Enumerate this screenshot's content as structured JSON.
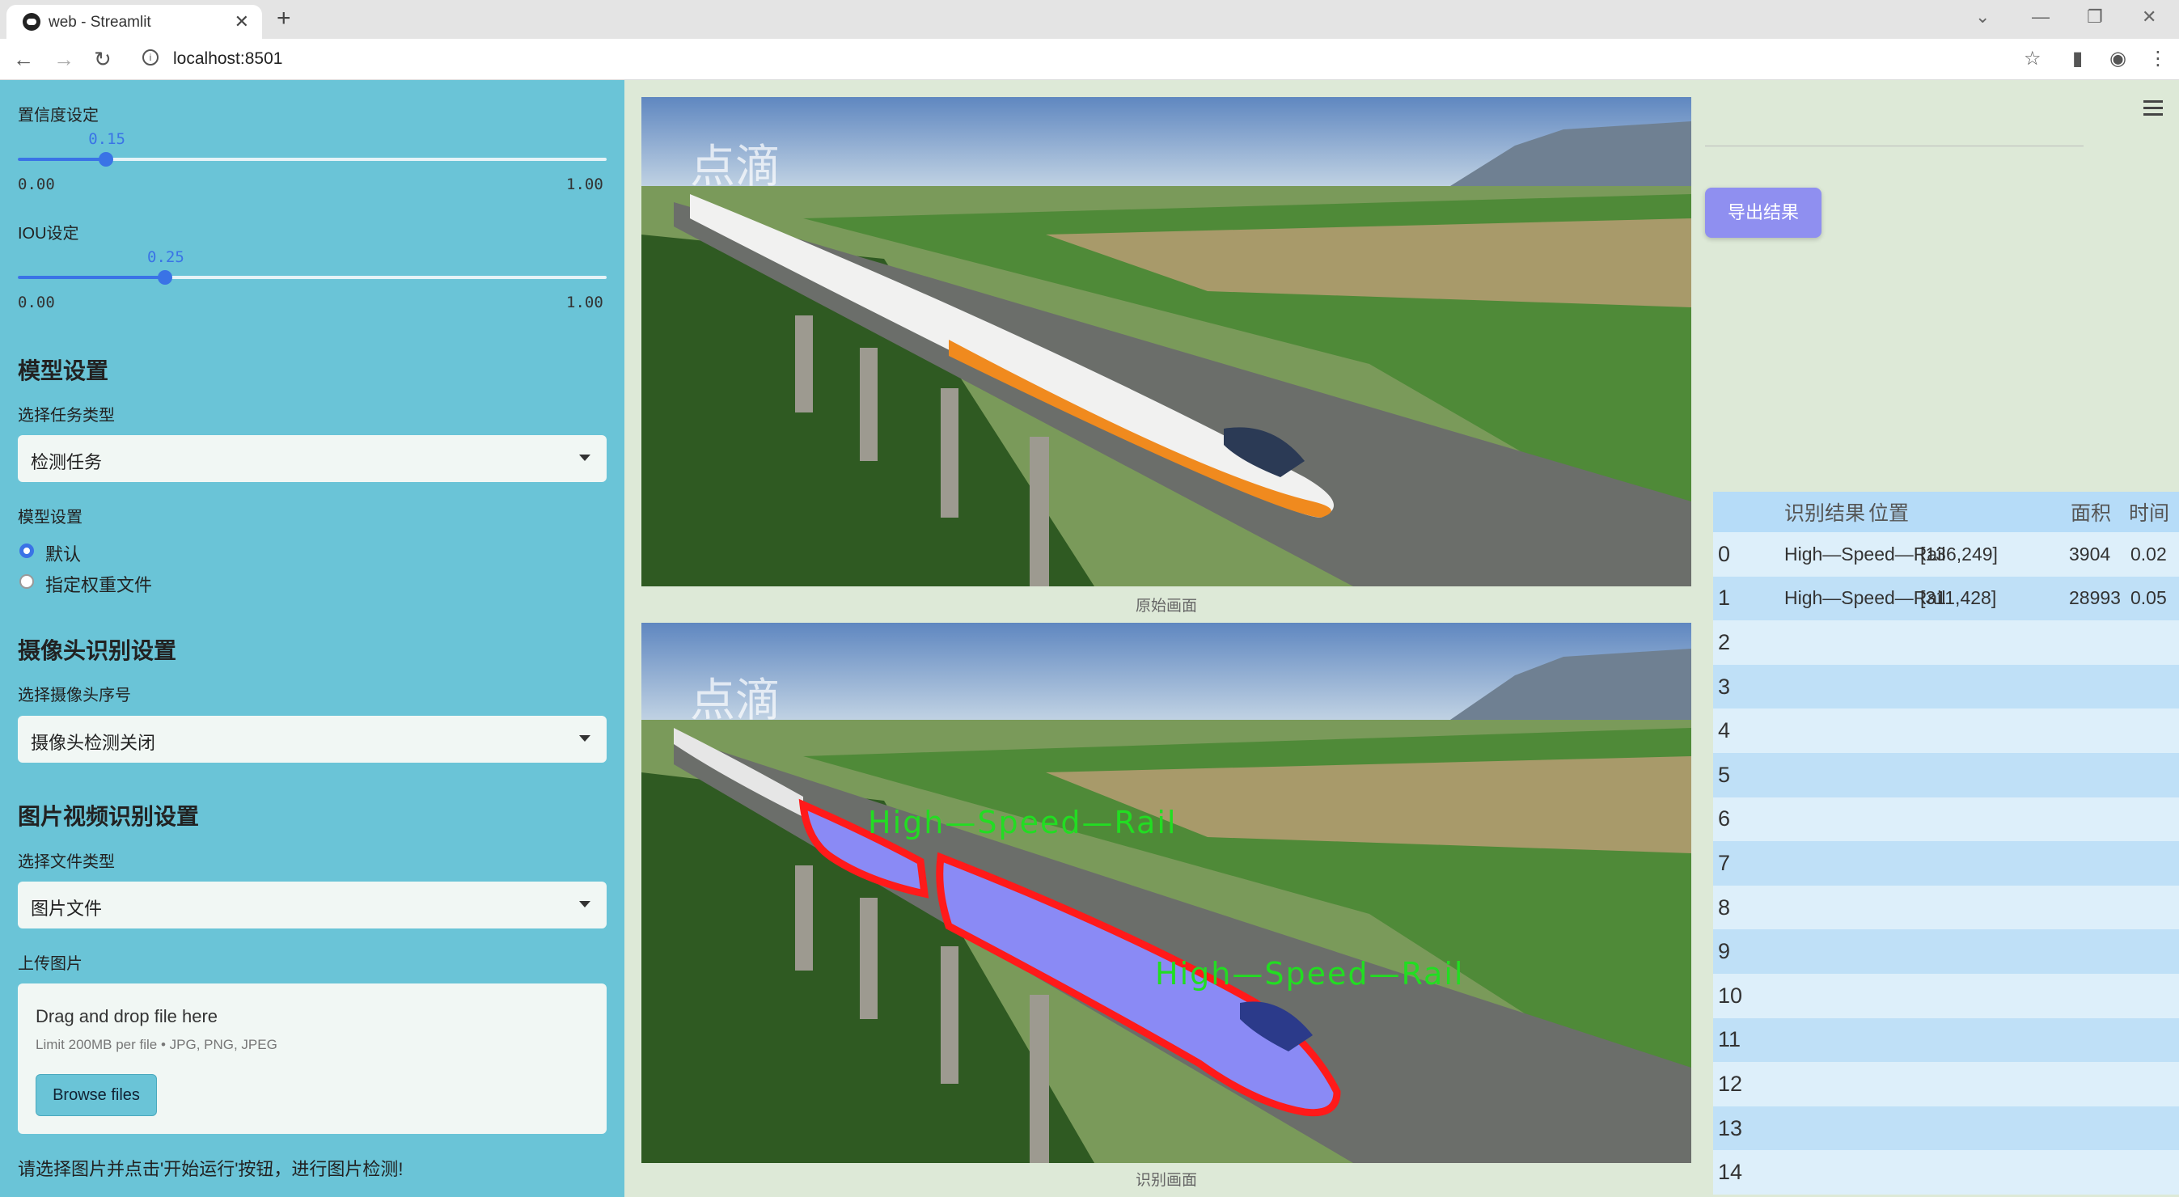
{
  "browser": {
    "tab_title": "web - Streamlit",
    "url": "localhost:8501"
  },
  "sidebar": {
    "confidence": {
      "label": "置信度设定",
      "value": "0.15",
      "value_num": 0.15,
      "min": "0.00",
      "max": "1.00"
    },
    "iou": {
      "label": "IOU设定",
      "value": "0.25",
      "value_num": 0.25,
      "min": "0.00",
      "max": "1.00"
    },
    "model_section": {
      "title": "模型设置",
      "task_label": "选择任务类型",
      "task_value": "检测任务",
      "model_label": "模型设置",
      "options": [
        "默认",
        "指定权重文件"
      ],
      "selected": "默认"
    },
    "camera_section": {
      "title": "摄像头识别设置",
      "camera_label": "选择摄像头序号",
      "camera_value": "摄像头检测关闭"
    },
    "media_section": {
      "title": "图片视频识别设置",
      "type_label": "选择文件类型",
      "type_value": "图片文件",
      "upload_label": "上传图片",
      "dropzone_text": "Drag and drop file here",
      "dropzone_limit": "Limit 200MB per file • JPG, PNG, JPEG",
      "browse_label": "Browse files"
    },
    "hint": "请选择图片并点击'开始运行'按钮，进行图片检测!"
  },
  "main": {
    "original_caption": "原始画面",
    "result_caption": "识别画面",
    "detection_label_1": "High—Speed—Rail",
    "detection_label_2": "High—Speed—Rail",
    "watermark": "点滴",
    "export_label": "导出结果"
  },
  "colors": {
    "sidebar_bg": "#6ac4d7",
    "accent": "#3a73e6",
    "mask_fill": "#8a8af5",
    "mask_outline": "#ff1a1a",
    "label_green": "#22dd22",
    "export_btn": "#8f8ff0"
  },
  "table": {
    "headers": [
      "",
      "识别结果",
      "位置",
      "面积",
      "时间"
    ],
    "rows": [
      {
        "idx": "0",
        "result": "High—Speed—Rail",
        "pos": "[136,249]",
        "area": "3904",
        "time": "0.02"
      },
      {
        "idx": "1",
        "result": "High—Speed—Rail",
        "pos": "[311,428]",
        "area": "28993",
        "time": "0.05"
      },
      {
        "idx": "2",
        "result": "",
        "pos": "",
        "area": "",
        "time": ""
      },
      {
        "idx": "3",
        "result": "",
        "pos": "",
        "area": "",
        "time": ""
      },
      {
        "idx": "4",
        "result": "",
        "pos": "",
        "area": "",
        "time": ""
      },
      {
        "idx": "5",
        "result": "",
        "pos": "",
        "area": "",
        "time": ""
      },
      {
        "idx": "6",
        "result": "",
        "pos": "",
        "area": "",
        "time": ""
      },
      {
        "idx": "7",
        "result": "",
        "pos": "",
        "area": "",
        "time": ""
      },
      {
        "idx": "8",
        "result": "",
        "pos": "",
        "area": "",
        "time": ""
      },
      {
        "idx": "9",
        "result": "",
        "pos": "",
        "area": "",
        "time": ""
      },
      {
        "idx": "10",
        "result": "",
        "pos": "",
        "area": "",
        "time": ""
      },
      {
        "idx": "11",
        "result": "",
        "pos": "",
        "area": "",
        "time": ""
      },
      {
        "idx": "12",
        "result": "",
        "pos": "",
        "area": "",
        "time": ""
      },
      {
        "idx": "13",
        "result": "",
        "pos": "",
        "area": "",
        "time": ""
      },
      {
        "idx": "14",
        "result": "",
        "pos": "",
        "area": "",
        "time": ""
      }
    ]
  }
}
